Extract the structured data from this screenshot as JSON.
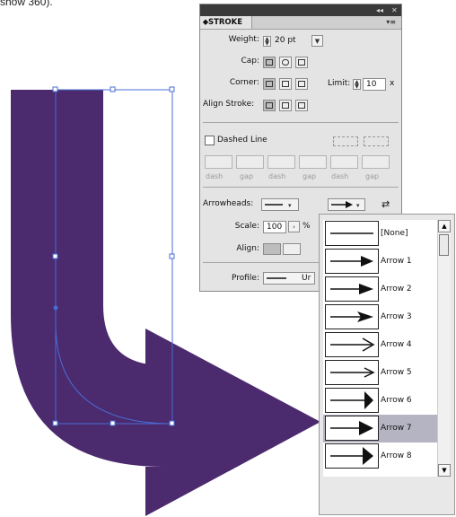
{
  "caption_fragment": "show 360).",
  "panel": {
    "tab": "⬥STROKE",
    "collapse_icon": "◂◂",
    "close_icon": "✕",
    "menu_icon": "▾≡",
    "weight_label": "Weight:",
    "weight_value": "20 pt",
    "cap_label": "Cap:",
    "corner_label": "Corner:",
    "limit_label": "Limit:",
    "limit_value": "10",
    "limit_unit": "x",
    "align_stroke_label": "Align Stroke:",
    "dashed_line_label": "Dashed Line",
    "dash_gap_labels": [
      "dash",
      "gap",
      "dash",
      "gap",
      "dash",
      "gap"
    ],
    "arrowheads_label": "Arrowheads:",
    "swap_icon": "⇄",
    "scale_label": "Scale:",
    "scale_value": "100",
    "scale_unit": "%",
    "align_label": "Align:",
    "profile_label": "Profile:",
    "profile_value": "Ur"
  },
  "arrowhead_menu": {
    "selected": "Arrow 7",
    "items": [
      "[None]",
      "Arrow 1",
      "Arrow 2",
      "Arrow 3",
      "Arrow 4",
      "Arrow 5",
      "Arrow 6",
      "Arrow 7",
      "Arrow 8"
    ]
  },
  "colors": {
    "arrow_fill": "#4b2a6e",
    "selection": "#4a6cd4",
    "menu_selected": "#b4b4c2"
  }
}
